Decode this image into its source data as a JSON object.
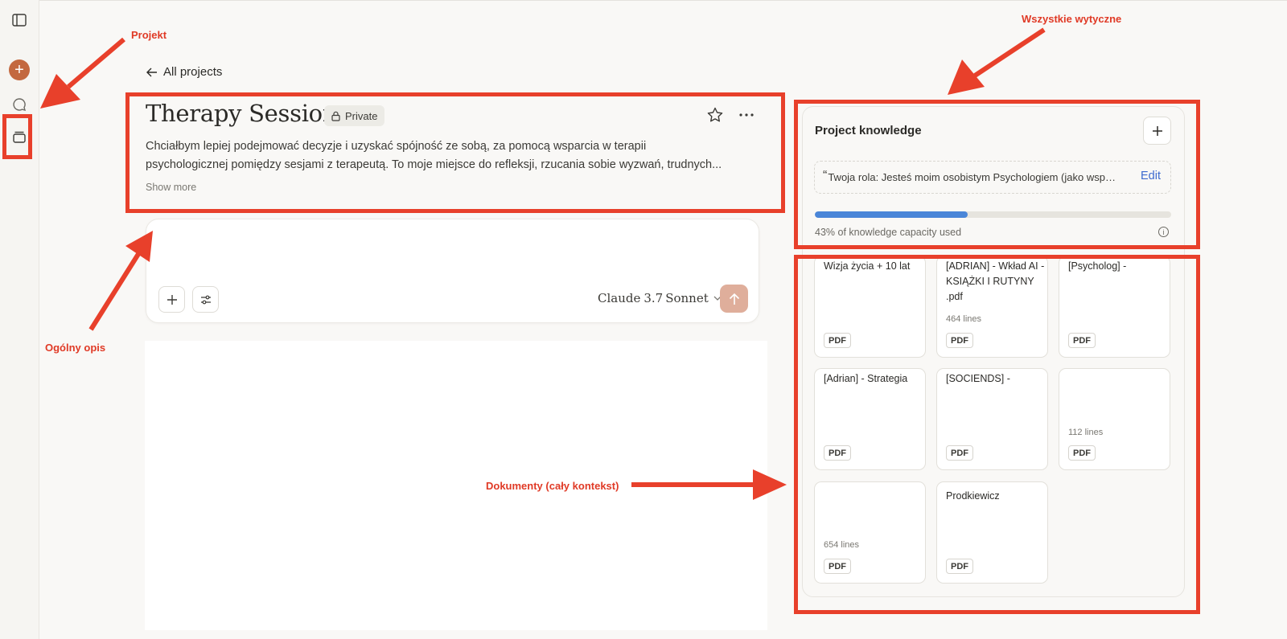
{
  "nav": {
    "back_label": "All projects"
  },
  "project": {
    "title": "Therapy Session",
    "visibility": "Private",
    "description_line1": "Chciałbym lepiej podejmować decyzje i uzyskać spójność ze sobą, za pomocą wsparcia w terapii",
    "description_line2": "psychologicznej pomiędzy sesjami z terapeutą. To moje miejsce do refleksji, rzucania sobie wyzwań, trudnych...",
    "show_more": "Show more"
  },
  "composer": {
    "model_brand": "Claude",
    "model_version": "3.7",
    "model_name": "Sonnet"
  },
  "knowledge": {
    "title": "Project knowledge",
    "instructions_preview": "Twoja rola: Jesteś moim osobistym Psychologiem (jako wspar...",
    "edit_label": "Edit",
    "capacity_fraction": 0.43,
    "capacity_text": "43% of knowledge capacity used",
    "files": [
      {
        "name": "Wizja życia + 10 lat",
        "lines": "",
        "type": "PDF"
      },
      {
        "name": "[ADRIAN] - Wkład AI - KSIĄŻKI I RUTYNY .pdf",
        "lines": "464 lines",
        "type": "PDF"
      },
      {
        "name": "[Psycholog] -",
        "lines": "",
        "type": "PDF"
      },
      {
        "name": "[Adrian] - Strategia",
        "lines": "",
        "type": "PDF"
      },
      {
        "name": "[SOCIENDS] -",
        "lines": "",
        "type": "PDF"
      },
      {
        "name": "",
        "lines": "112 lines",
        "type": "PDF"
      },
      {
        "name": "",
        "lines": "654 lines",
        "type": "PDF"
      },
      {
        "name": "Prodkiewicz",
        "lines": "",
        "type": "PDF"
      }
    ]
  },
  "annotations": {
    "projekt": "Projekt",
    "wytyczne": "Wszystkie wytyczne",
    "opis": "Ogólny opis",
    "dokumenty": "Dokumenty (cały kontekst)"
  },
  "colors": {
    "annotation_red": "#e8402b",
    "accent_orange": "#c3683f",
    "progress_blue": "#4a86d8",
    "send_button": "#dfae9b"
  }
}
